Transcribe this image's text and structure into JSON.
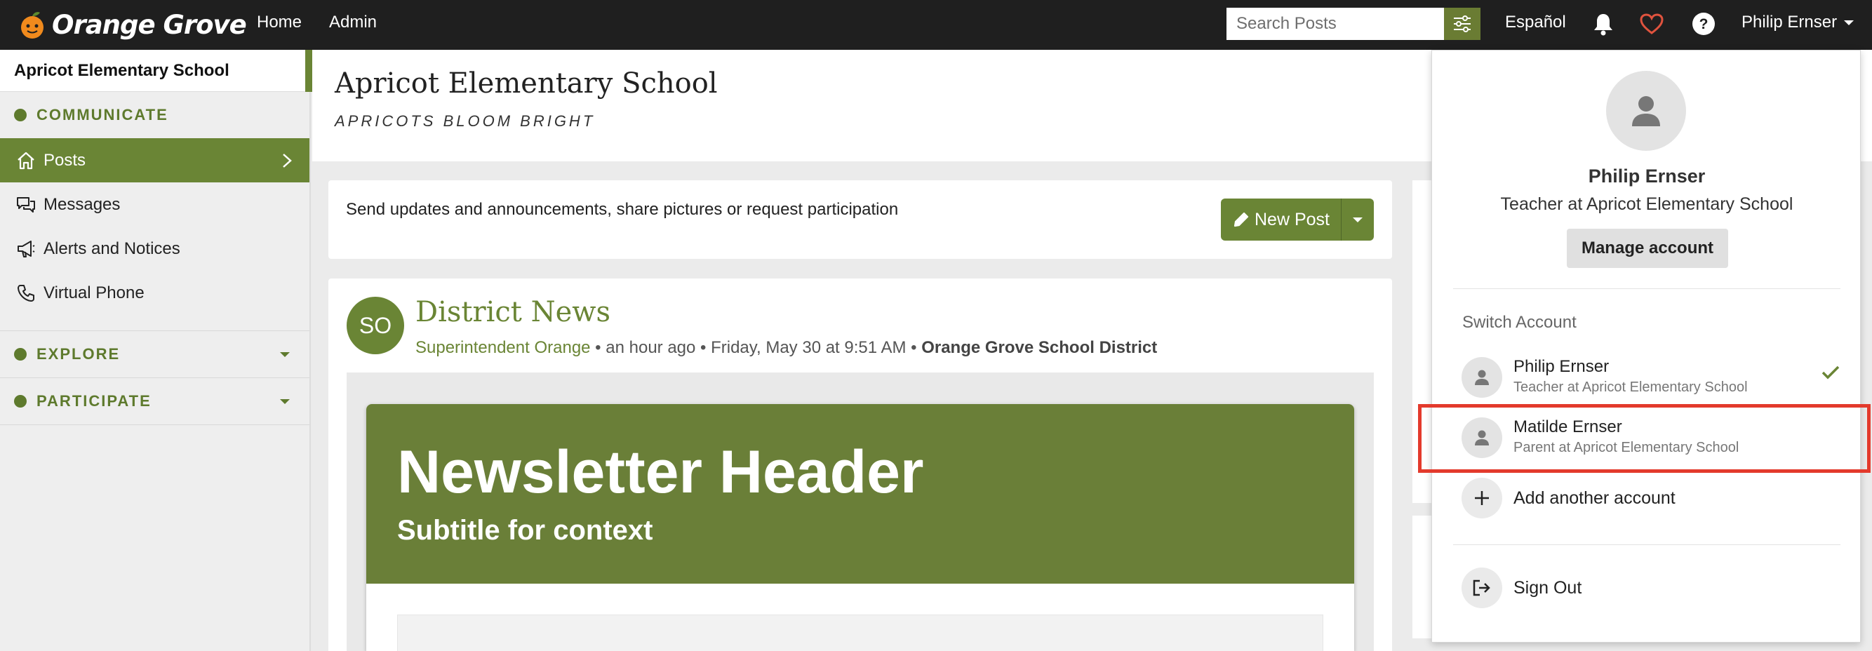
{
  "topbar": {
    "brand": "Orange Grove",
    "nav": [
      "Home",
      "Admin"
    ],
    "search_placeholder": "Search Posts",
    "language": "Español",
    "user": "Philip Ernser",
    "icons": [
      "bell-icon",
      "heart-icon",
      "help-icon"
    ],
    "heart_color": "#e0533e"
  },
  "sidebar": {
    "school": "Apricot Elementary School",
    "communicate": "COMMUNICATE",
    "items": [
      {
        "label": "Posts",
        "icon": "home-icon",
        "active": true
      },
      {
        "label": "Messages",
        "icon": "chat-icon"
      },
      {
        "label": "Alerts and Notices",
        "icon": "megaphone-icon"
      },
      {
        "label": "Virtual Phone",
        "icon": "phone-icon"
      }
    ],
    "explore": "EXPLORE",
    "participate": "PARTICIPATE"
  },
  "school": {
    "title": "Apricot Elementary School",
    "motto": "APRICOTS BLOOM BRIGHT"
  },
  "composer": {
    "prompt": "Send updates and announcements, share pictures or request participation",
    "new_post": "New Post"
  },
  "post": {
    "avatar_initials": "SO",
    "title": "District News",
    "author": "Superintendent Orange",
    "meta": " • an hour ago • Friday, May 30 at 9:51 AM • ",
    "district": "Orange Grove School District",
    "newsletter_title": "Newsletter Header",
    "newsletter_subtitle": "Subtitle for context"
  },
  "dropdown": {
    "name": "Philip Ernser",
    "role": "Teacher at Apricot Elementary School",
    "manage": "Manage account",
    "switch_label": "Switch Account",
    "accounts": [
      {
        "name": "Philip Ernser",
        "role": "Teacher at Apricot Elementary School",
        "current": true
      },
      {
        "name": "Matilde Ernser",
        "role": "Parent at Apricot Elementary School",
        "current": false
      }
    ],
    "add_account": "Add another account",
    "sign_out": "Sign Out"
  },
  "colors": {
    "brand_green": "#6a8535",
    "highlight_red": "#e33a2c",
    "topbar": "#1f1f1f"
  }
}
